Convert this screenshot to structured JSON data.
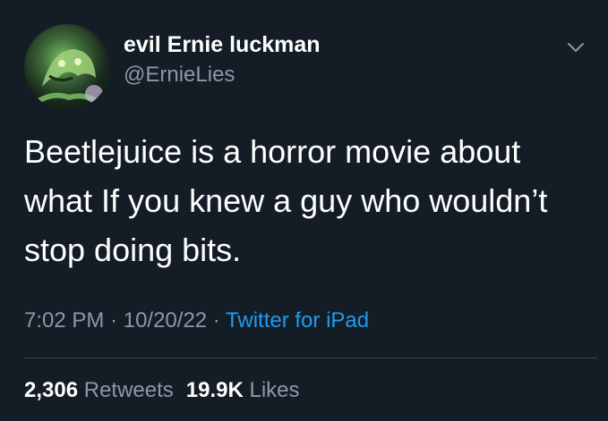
{
  "tweet": {
    "author": {
      "display_name": "evil Ernie luckman",
      "handle": "@ErnieLies",
      "avatar_icon": "avatar-icon"
    },
    "menu_icon": "chevron-down-icon",
    "text_lines": [
      "Beetlejuice is a horror movie about",
      "what If you knew a guy who wouldn’t",
      "stop doing bits."
    ],
    "meta": {
      "time": "7:02 PM",
      "sep1": " · ",
      "date": "10/20/22",
      "sep2": " · ",
      "source": "Twitter for iPad"
    },
    "stats": {
      "retweets_count": "2,306",
      "retweets_label": "Retweets",
      "likes_count": "19.9K",
      "likes_label": "Likes"
    }
  },
  "colors": {
    "background": "#141d26",
    "text": "#ffffff",
    "secondary": "#8b98a5",
    "link": "#1d9bf0",
    "divider": "#38444d"
  }
}
